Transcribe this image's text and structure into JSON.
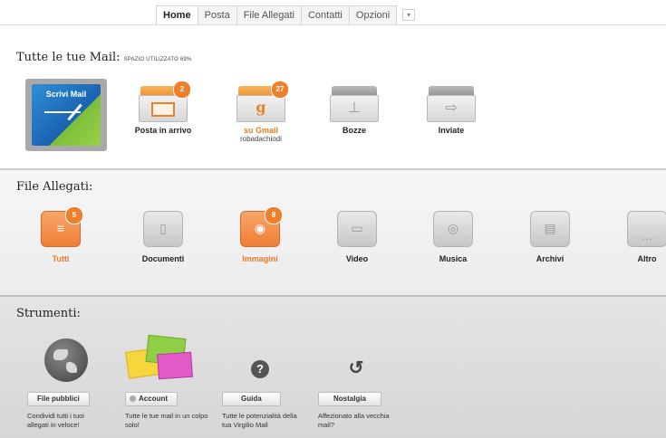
{
  "tabs": [
    {
      "label": "Home"
    },
    {
      "label": "Posta"
    },
    {
      "label": "File Allegati"
    },
    {
      "label": "Contatti"
    },
    {
      "label": "Opzioni"
    }
  ],
  "mail_section": {
    "title": "Tutte le tue Mail:",
    "space": "SPAZIO UTILIZZATO 69%",
    "scrivi": "Scrivi Mail",
    "items": [
      {
        "label": "Posta in arrivo",
        "badge": "2",
        "icon": "envelope-icon"
      },
      {
        "label": "su Gmail",
        "sub": "robadachiodi",
        "badge": "27",
        "icon": "gmail-icon"
      },
      {
        "label": "Bozze",
        "icon": "pin-icon"
      },
      {
        "label": "Inviate",
        "icon": "send-icon"
      }
    ]
  },
  "files_section": {
    "title": "File Allegati:",
    "items": [
      {
        "label": "Tutti",
        "badge": "5",
        "icon": "all-files-icon"
      },
      {
        "label": "Documenti",
        "icon": "document-icon"
      },
      {
        "label": "Immagini",
        "badge": "8",
        "icon": "camera-icon"
      },
      {
        "label": "Video",
        "icon": "video-camera-icon"
      },
      {
        "label": "Musica",
        "icon": "music-player-icon"
      },
      {
        "label": "Archivi",
        "icon": "archive-icon"
      },
      {
        "label": "Altro",
        "icon": "more-icon"
      }
    ]
  },
  "tools_section": {
    "title": "Strumenti:",
    "items": [
      {
        "button": "File pubblici",
        "desc": "Condividi tutti i tuoi allegati in veloce!",
        "icon": "globe-icon"
      },
      {
        "button": "Account",
        "desc": "Tutte le tue mail in un colpo solo!",
        "icon": "accounts-icon"
      },
      {
        "button": "Guida",
        "desc": "Tutte le potenzialità della tua Virgilio Mail",
        "icon": "help-icon"
      },
      {
        "button": "Nostalgia",
        "desc": "Affezionato alla vecchia mail?",
        "icon": "undo-icon"
      }
    ]
  },
  "colors": {
    "accent": "#f07f2b",
    "label_orange": "#e8782a"
  }
}
